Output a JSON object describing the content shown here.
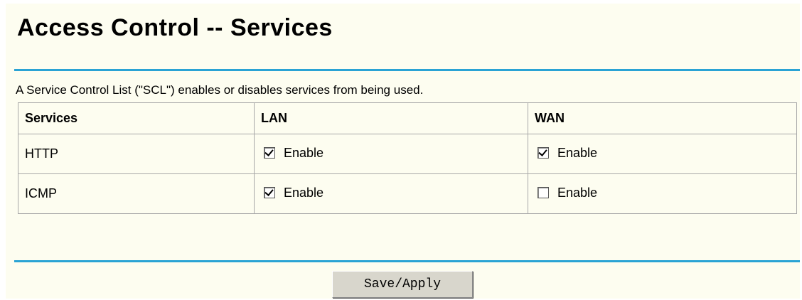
{
  "page": {
    "title": "Access Control -- Services",
    "description": "A Service Control List (\"SCL\") enables or disables services from being used."
  },
  "table": {
    "headers": [
      "Services",
      "LAN",
      "WAN"
    ],
    "rows": [
      {
        "service": "HTTP",
        "lan": {
          "checked": true,
          "label": "Enable"
        },
        "wan": {
          "checked": true,
          "label": "Enable"
        }
      },
      {
        "service": "ICMP",
        "lan": {
          "checked": true,
          "label": "Enable"
        },
        "wan": {
          "checked": false,
          "label": "Enable"
        }
      }
    ]
  },
  "actions": {
    "save_label": "Save/Apply"
  },
  "colors": {
    "accent_rule": "#2aa3d4",
    "panel_bg": "#fdfdf0",
    "button_bg": "#d8d6cc"
  }
}
